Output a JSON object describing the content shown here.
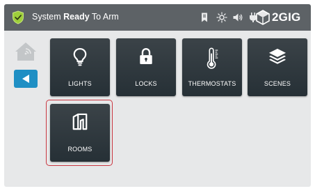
{
  "status_bar": {
    "status_prefix": "System ",
    "status_bold": "Ready",
    "status_suffix": " To Arm",
    "brand": "2GIG"
  },
  "tiles": [
    {
      "label": "LIGHTS",
      "icon": "lightbulb-icon"
    },
    {
      "label": "LOCKS",
      "icon": "lock-icon"
    },
    {
      "label": "THERMOSTATS",
      "icon": "thermometer-icon"
    },
    {
      "label": "SCENES",
      "icon": "layers-icon"
    },
    {
      "label": "ROOMS",
      "icon": "rooms-icon"
    }
  ],
  "colors": {
    "status_bar": "#5d6266",
    "accent_blue": "#1f8fc4",
    "tile": "#2d363b",
    "selection": "#c9353f",
    "shield": "#9ecf3b"
  }
}
